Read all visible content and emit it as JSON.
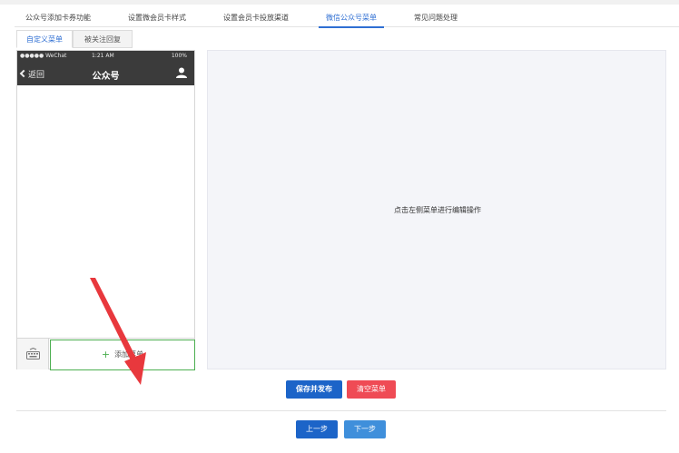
{
  "main_tabs": [
    {
      "label": "公众号添加卡券功能",
      "active": false
    },
    {
      "label": "设置微会员卡样式",
      "active": false
    },
    {
      "label": "设置会员卡投放渠道",
      "active": false
    },
    {
      "label": "微信公众号菜单",
      "active": true
    },
    {
      "label": "常见问题处理",
      "active": false
    }
  ],
  "sub_tabs": [
    {
      "label": "自定义菜单",
      "active": true
    },
    {
      "label": "被关注回复",
      "active": false
    }
  ],
  "phone": {
    "carrier": "●●●●● WeChat",
    "time": "1:21 AM",
    "battery": "100%",
    "back_label": "返回",
    "title": "公众号",
    "add_menu_label": "添加菜单",
    "icons": {
      "user": "user-icon",
      "keyboard": "keyboard-icon",
      "back": "chevron-left-icon",
      "plus": "plus-icon"
    }
  },
  "edit_area": {
    "hint": "点击左侧菜单进行编辑操作"
  },
  "actions": {
    "save_label": "保存并发布",
    "clear_label": "清空菜单",
    "prev_label": "上一步",
    "next_label": "下一步"
  },
  "colors": {
    "accent": "#2f6fd3",
    "primary_button": "#1c64c8",
    "danger_button": "#ef4b55",
    "add_menu_border": "#4caf50",
    "annotation_arrow": "#e8383d"
  }
}
